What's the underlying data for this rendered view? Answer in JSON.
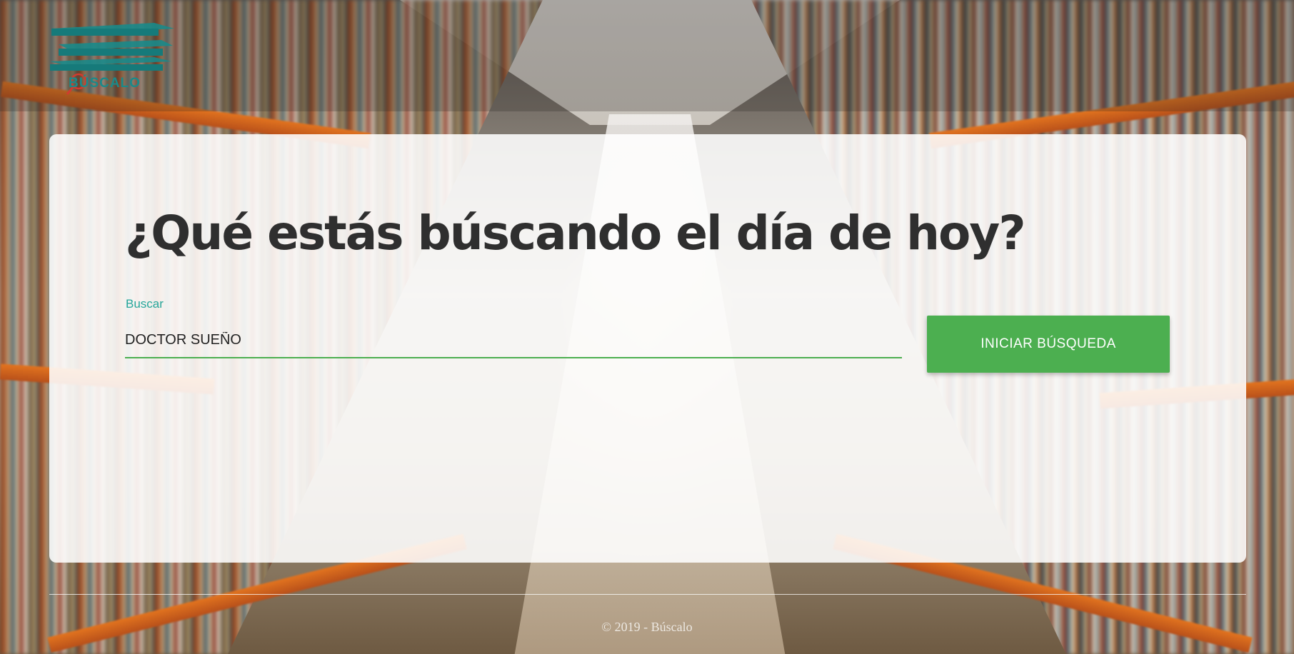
{
  "logo": {
    "text": "BÚSCALO",
    "color": "#1a8a8a",
    "accent": "#d13b2f"
  },
  "main": {
    "headline": "¿Qué estás búscando el día de hoy?",
    "search": {
      "label": "Buscar",
      "value": "DOCTOR SUEÑO",
      "placeholder": ""
    },
    "button_label": "INICIAR BÚSQUEDA"
  },
  "footer": {
    "text": "© 2019 - Búscalo"
  },
  "colors": {
    "primary": "#4caf50",
    "label": "#26a69a",
    "headline": "#2f2f2f"
  }
}
